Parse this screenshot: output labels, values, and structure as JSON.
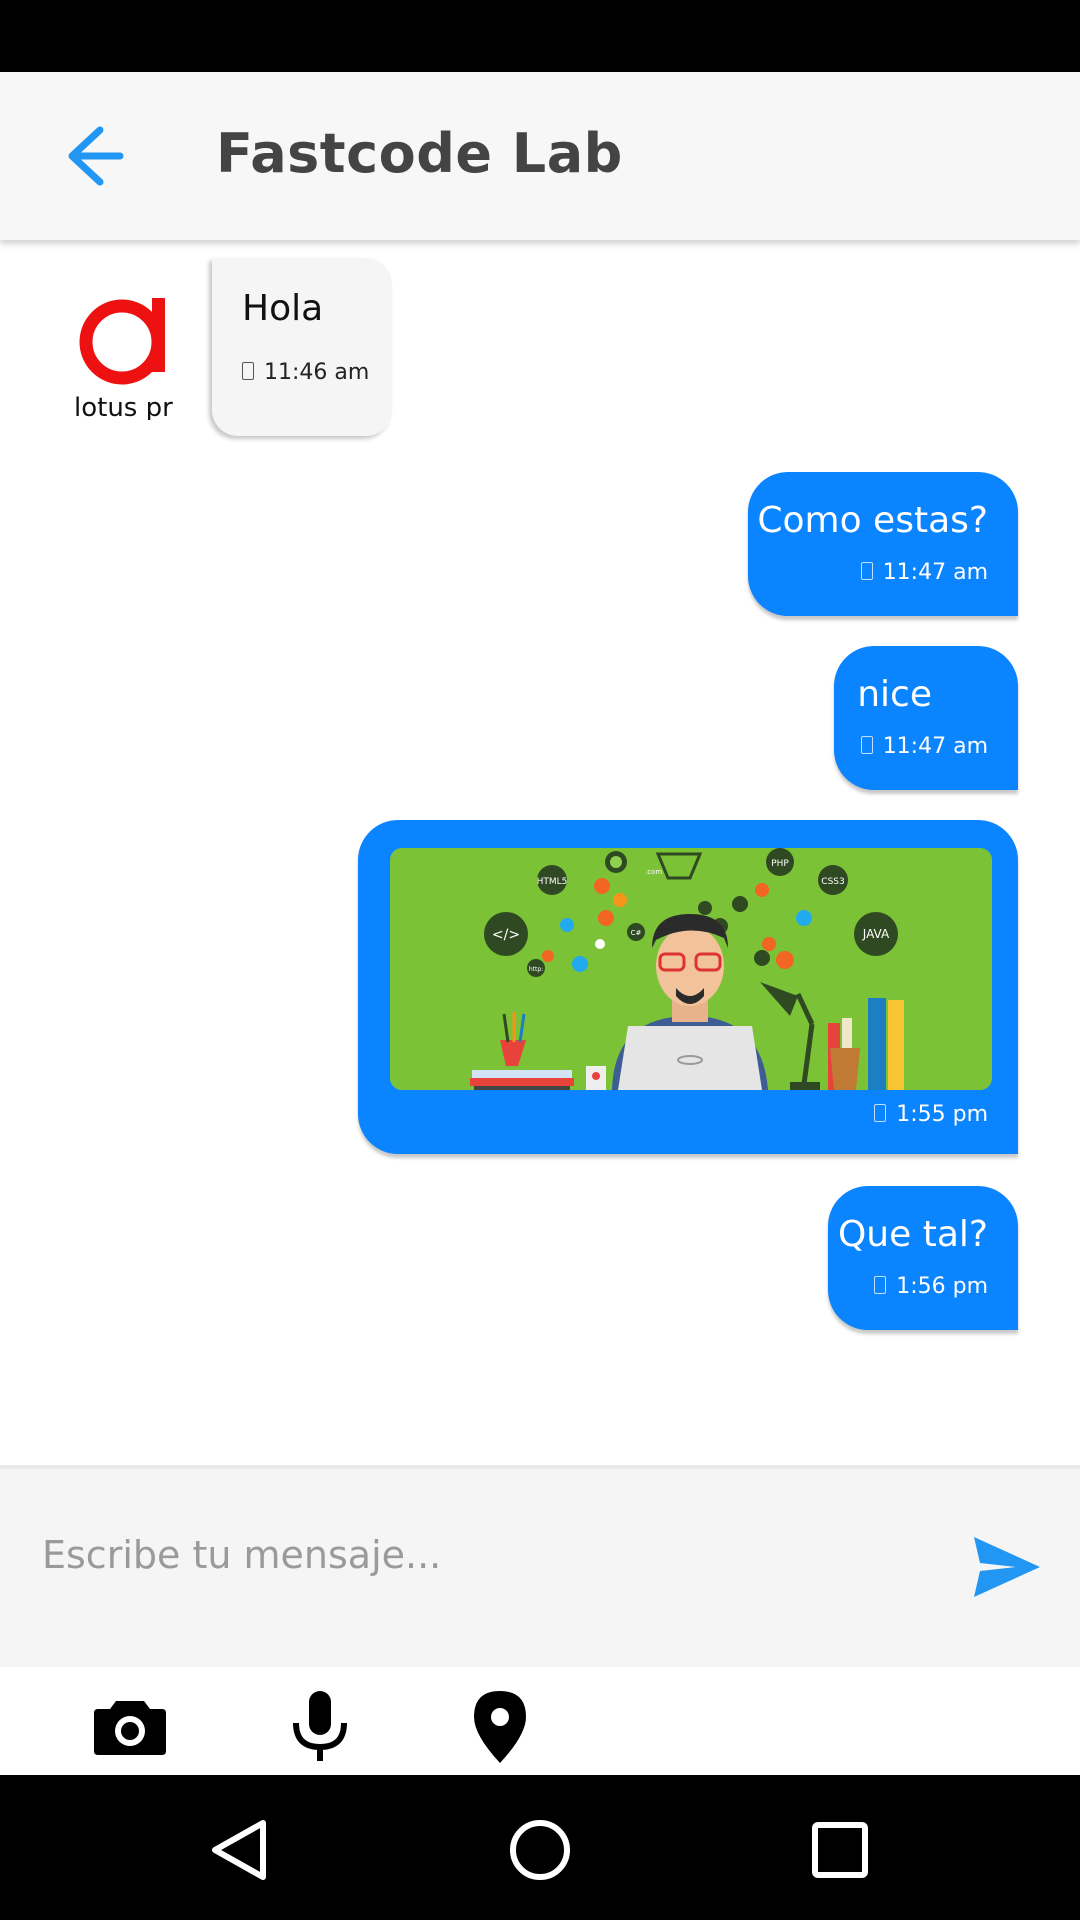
{
  "app_bar": {
    "title": "Fastcode Lab",
    "back_icon": "arrow-back-icon",
    "accent_color": "#2196f3"
  },
  "messages": [
    {
      "direction": "incoming",
      "text": "Hola",
      "time": "11:46 am",
      "avatar_text": "lotus pr"
    },
    {
      "direction": "outgoing",
      "text": "Como estas?",
      "time": "11:47 am"
    },
    {
      "direction": "outgoing",
      "text": "nice",
      "time": "11:47 am"
    },
    {
      "direction": "outgoing",
      "type": "image",
      "time": "1:55 pm",
      "image_labels": [
        "HTML5",
        "PHP",
        "CSS3",
        "JAVA",
        "</>",
        "C#",
        ".com",
        "http:"
      ]
    },
    {
      "direction": "outgoing",
      "text": "Que tal?",
      "time": "1:56 pm"
    }
  ],
  "composer": {
    "placeholder": "Escribe tu mensaje...",
    "send_icon": "send-icon"
  },
  "toolbar": {
    "icons": [
      "camera-icon",
      "microphone-icon",
      "location-pin-icon"
    ]
  },
  "nav": {
    "icons": [
      "nav-back-icon",
      "nav-home-icon",
      "nav-recents-icon"
    ]
  },
  "colors": {
    "outgoing_bubble": "#0a84ff",
    "incoming_bubble": "#f5f5f5",
    "image_background": "#7bc236"
  }
}
